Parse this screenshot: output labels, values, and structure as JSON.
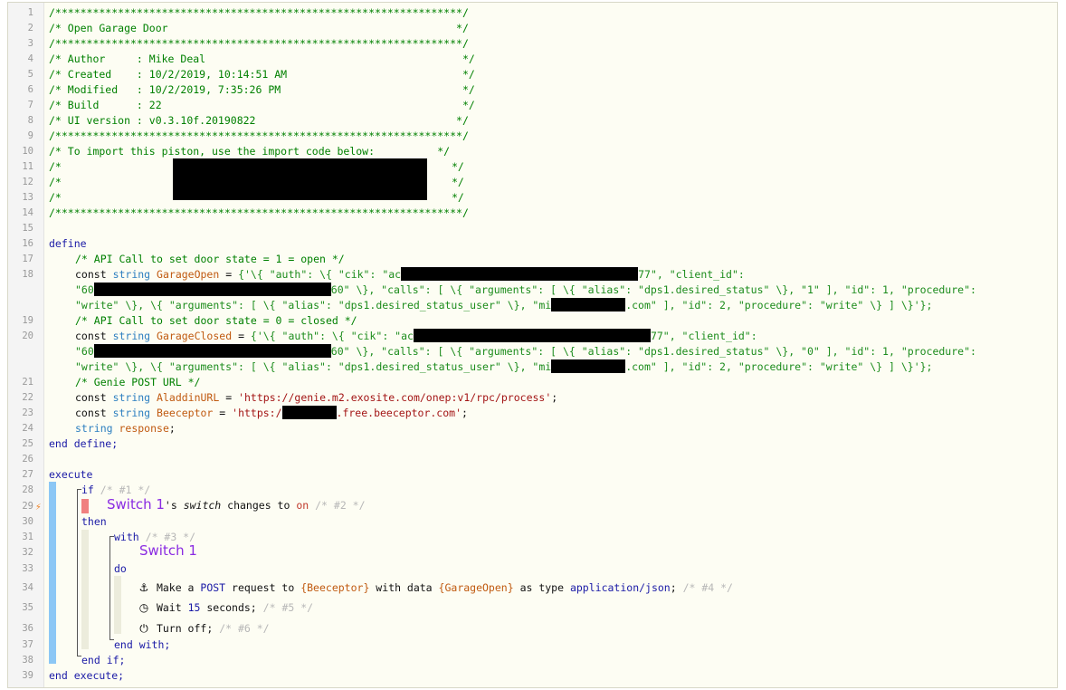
{
  "gutter": {
    "line_numbers": [
      "1",
      "2",
      "3",
      "4",
      "5",
      "6",
      "7",
      "8",
      "9",
      "10",
      "11",
      "12",
      "13",
      "14",
      "15",
      "16",
      "17",
      "18",
      "19",
      "20",
      "21",
      "22",
      "23",
      "24",
      "25",
      "26",
      "27",
      "28",
      "29",
      "30",
      "31",
      "32",
      "33",
      "34",
      "35",
      "36",
      "37",
      "38",
      "39"
    ]
  },
  "header": {
    "border": "/*****************************************************************/",
    "title": "/* Open Garage Door                                              */",
    "author": "/* Author     : Mike Deal                                         */",
    "created": "/* Created    : 10/2/2019, 10:14:51 AM                            */",
    "modified": "/* Modified   : 10/2/2019, 7:35:26 PM                             */",
    "build": "/* Build      : 22                                                */",
    "ui_version": "/* UI version : v0.3.10f.20190822                                */",
    "import_note": "/* To import this piston, use the import code below:          */",
    "import_line_start": "/*",
    "import_line_end": "*/"
  },
  "define": {
    "kw_define": "define",
    "comment_open": "/* API Call to set door state = 1 = open */",
    "comment_closed": "/* API Call to set door state = 0 = closed */",
    "comment_genie": "/* Genie POST URL */",
    "kw_const": "const",
    "kw_string": "string",
    "var_garage_open": "GarageOpen",
    "var_garage_closed": "GarageClosed",
    "var_aladdin": "AladdinURL",
    "var_beeceptor": "Beeceptor",
    "var_response": "response",
    "eq": " = ",
    "open_l1a": "{'\\{ \"auth\": \\{ \"cik\": \"ac",
    "open_l1b": "77\", \"client_id\":",
    "open_l2a": "\"60",
    "open_l2b": "60\" \\}, \"calls\": [ \\{ \"arguments\": [ \\{ \"alias\": \"dps1.desired_status\" \\}, \"1\" ], \"id\": 1, \"procedure\":",
    "open_l3a": "\"write\" \\}, \\{ \"arguments\": [ \\{ \"alias\": \"dps1.desired_status_user\" \\}, \"mi",
    "open_l3b": ".com\" ], \"id\": 2, \"procedure\": \"write\" \\} ] \\}'};",
    "closed_l1a": "{'\\{ \"auth\": \\{ \"cik\": \"ac",
    "closed_l1b": "77\", \"client_id\":",
    "closed_l2a": "\"60",
    "closed_l2b": "60\" \\}, \"calls\": [ \\{ \"arguments\": [ \\{ \"alias\": \"dps1.desired_status\" \\}, \"0\" ], \"id\": 1, \"procedure\":",
    "closed_l3a": "\"write\" \\}, \\{ \"arguments\": [ \\{ \"alias\": \"dps1.desired_status_user\" \\}, \"mi",
    "closed_l3b": ".com\" ], \"id\": 2, \"procedure\": \"write\" \\} ] \\}'};",
    "aladdin_value": "'https://genie.m2.exosite.com/onep:v1/rpc/process'",
    "beeceptor_a": "'https:/",
    "beeceptor_b": ".free.beeceptor.com'",
    "semicolon": ";",
    "kw_end_define": "end define;"
  },
  "execute": {
    "kw_execute": "execute",
    "kw_if": "if",
    "cm1": "/* #1 */",
    "device": "Switch 1",
    "cond_mid": "'s ",
    "cond_attr": "switch",
    "cond_changes": " changes to ",
    "cond_on": "on",
    "cm2": "/* #2 */",
    "kw_then": "then",
    "kw_with": "with",
    "cm3": "/* #3 */",
    "with_device": "Switch 1",
    "kw_do": "do",
    "task1_a": "Make a ",
    "task1_post": "POST",
    "task1_b": " request to ",
    "task1_url": "{Beeceptor}",
    "task1_c": " with data ",
    "task1_data": "{GarageOpen}",
    "task1_d": " as type ",
    "task1_type": "application/json",
    "task1_e": "; ",
    "cm4": "/* #4 */",
    "task2_a": "Wait ",
    "task2_num": "15",
    "task2_b": " seconds; ",
    "cm5": "/* #5 */",
    "task3_a": "Turn off; ",
    "cm6": "/* #6 */",
    "kw_end_with": "end with;",
    "kw_end_if": "end if;",
    "kw_end_execute": "end execute;"
  },
  "icons": {
    "anchor": "⚓",
    "clock": "◷",
    "power": "⏻",
    "bolt": "⚡"
  }
}
